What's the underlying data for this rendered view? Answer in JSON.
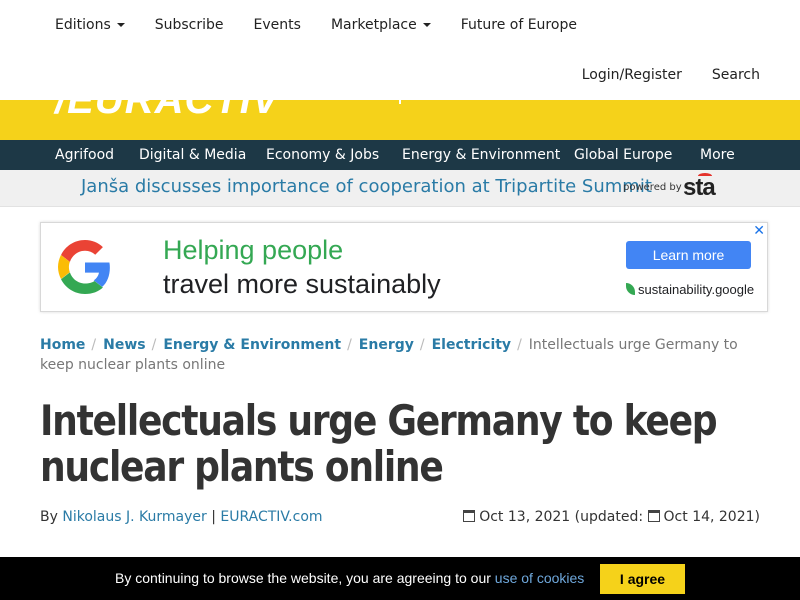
{
  "top_nav": {
    "editions": "Editions",
    "subscribe": "Subscribe",
    "events": "Events",
    "marketplace": "Marketplace",
    "future_of_europe": "Future of Europe",
    "login": "Login/Register",
    "search": "Search"
  },
  "brand": {
    "logo": "EURACTIV",
    "color": "#f5d21a"
  },
  "categories": [
    "Agrifood",
    "Digital & Media",
    "Economy & Jobs",
    "Energy & Environment",
    "Global Europe",
    "More"
  ],
  "ticker": {
    "headline": "Janša discusses importance of cooperation at Tripartite Summit",
    "powered_by": "powered by",
    "partner": "sta"
  },
  "ad": {
    "line1": "Helping people",
    "line2": "travel more sustainably",
    "button": "Learn more",
    "brand": "sustainability.google",
    "close": "✕"
  },
  "breadcrumb": {
    "home": "Home",
    "news": "News",
    "section": "Energy & Environment",
    "subsection": "Energy",
    "topic": "Electricity",
    "current": "Intellectuals urge Germany to keep nuclear plants online",
    "separator": "/"
  },
  "article": {
    "title": "Intellectuals urge Germany to keep nuclear plants online",
    "by": "By",
    "author": "Nikolaus J. Kurmayer",
    "pipe": "|",
    "outlet": "EURACTIV.com",
    "published": "Oct 13, 2021",
    "updated_label": "(updated:",
    "updated": "Oct 14, 2021)"
  },
  "cookie": {
    "text": "By continuing to browse the website, you are agreeing to our",
    "link": "use of cookies",
    "button": "I agree"
  }
}
